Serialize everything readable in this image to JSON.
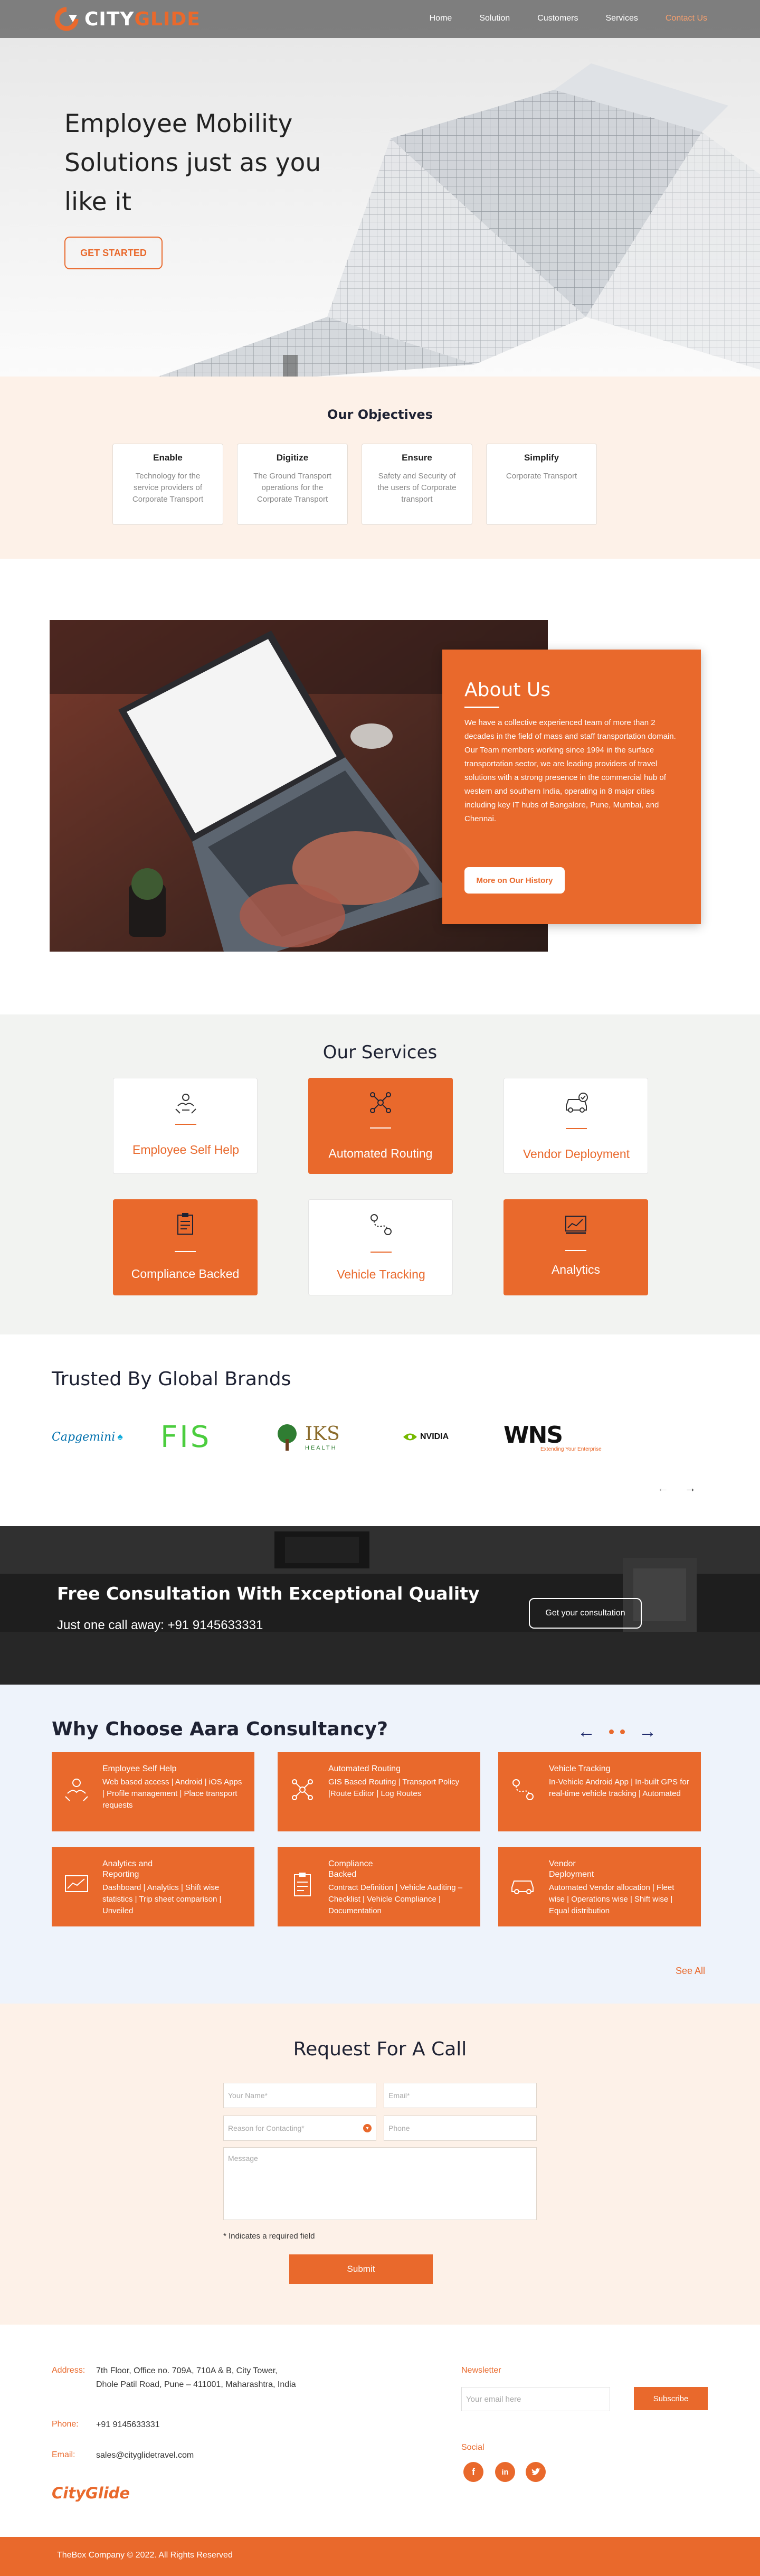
{
  "brand": {
    "name_part1": "CITY",
    "name_part2": "GLIDE"
  },
  "nav": {
    "items": [
      "Home",
      "Solution",
      "Customers",
      "Services",
      "Contact Us"
    ]
  },
  "hero": {
    "title": "Employee Mobility Solutions just as you like it",
    "cta": "GET STARTED"
  },
  "objectives": {
    "title": "Our Objectives",
    "cards": [
      {
        "title": "Enable",
        "text": "Technology for the service providers of Corporate Transport"
      },
      {
        "title": "Digitize",
        "text": "The Ground Transport operations for the Corporate Transport"
      },
      {
        "title": "Ensure",
        "text": "Safety and Security of the users of Corporate transport"
      },
      {
        "title": "Simplify",
        "text": "Corporate Transport"
      }
    ]
  },
  "about": {
    "title": "About Us",
    "text": "We have a collective experienced team of more than 2 decades in the field of mass and staff transportation domain. Our Team members working since 1994 in the surface transportation sector, we are leading providers of travel solutions with a strong presence in the commercial hub of western and southern India, operating in 8 major cities including key IT hubs of Bangalore, Pune, Mumbai, and Chennai.",
    "button": "More on Our History"
  },
  "services": {
    "title": "Our Services",
    "items": [
      {
        "label": "Employee Self Help",
        "icon": "self-help-icon"
      },
      {
        "label": "Automated Routing",
        "icon": "routing-icon"
      },
      {
        "label": "Vendor Deployment",
        "icon": "vendor-car-icon"
      },
      {
        "label": "Compliance Backed",
        "icon": "clipboard-icon"
      },
      {
        "label": "Vehicle Tracking",
        "icon": "tracking-icon"
      },
      {
        "label": "Analytics",
        "icon": "analytics-icon"
      }
    ]
  },
  "brands": {
    "title": "Trusted By Global Brands",
    "logos": [
      "Capgemini",
      "FIS",
      "IKS",
      "HEALTH",
      "NVIDIA",
      "WNS",
      "Extending Your Enterprise"
    ]
  },
  "consult": {
    "title": "Free Consultation With Exceptional Quality",
    "subtitle": "Just one call away: +91 9145633331",
    "button": "Get your consultation"
  },
  "why": {
    "title": "Why Choose Aara Consultancy?",
    "cards": [
      {
        "title": "Employee Self Help",
        "text": "Web based access | Android | iOS Apps | Profile management | Place transport requests"
      },
      {
        "title": "Automated Routing",
        "text": "GIS Based Routing | Transport Policy |Route Editor | Log Routes"
      },
      {
        "title": "Vehicle Tracking",
        "text": "In-Vehicle Android App | In-built GPS for real-time vehicle tracking | Automated"
      },
      {
        "title": "Analytics and Reporting",
        "text": "Dashboard | Analytics | Shift wise statistics | Trip sheet comparison | Unveiled"
      },
      {
        "title": "Compliance Backed",
        "text": "Contract Definition | Vehicle Auditing – Checklist | Vehicle Compliance | Documentation"
      },
      {
        "title": "Vendor Deployment",
        "text": "Automated Vendor allocation | Fleet wise | Operations wise | Shift wise | Equal distribution"
      }
    ],
    "see_all": "See All"
  },
  "request": {
    "title": "Request For A Call",
    "name_ph": "Your Name*",
    "email_ph": "Email*",
    "reason_ph": "Reason for Contacting*",
    "phone_ph": "Phone",
    "message_ph": "Message",
    "note": "* Indicates a required field",
    "submit": "Submit"
  },
  "footer": {
    "address_label": "Address:",
    "address": "7th Floor, Office no. 709A, 710A & B, City Tower, Dhole Patil Road, Pune – 411001, Maharashtra, India",
    "phone_label": "Phone:",
    "phone": "+91 9145633331",
    "email_label": "Email:",
    "email": "sales@cityglidetravel.com",
    "brand": "CityGlide",
    "newsletter_label": "Newsletter",
    "newsletter_ph": "Your email here",
    "subscribe": "Subscribe",
    "social_label": "Social",
    "social": [
      "facebook-icon",
      "linkedin-icon",
      "twitter-icon"
    ]
  },
  "copyright": "TheBox Company © 2022. All Rights Reserved",
  "colors": {
    "accent": "#e9692c",
    "dark": "#1e2233"
  }
}
